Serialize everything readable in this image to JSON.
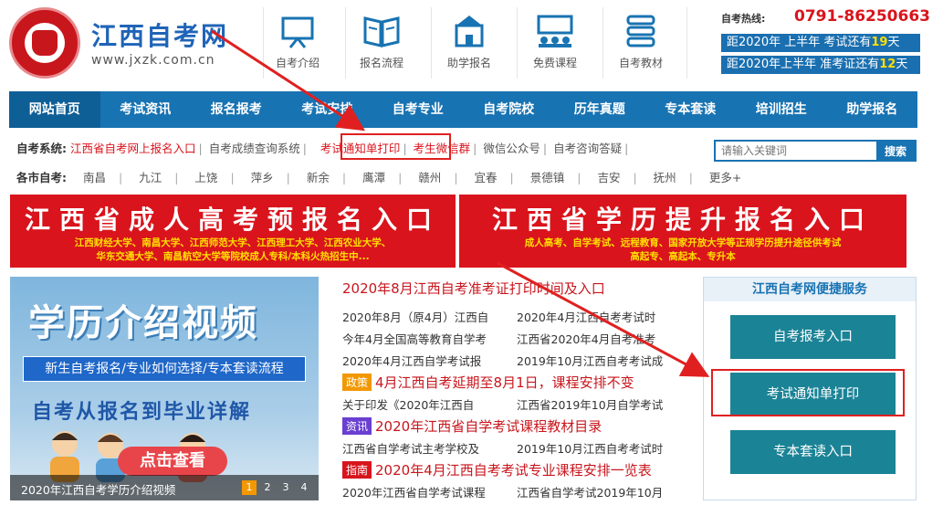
{
  "header": {
    "site_name": "江西自考网",
    "site_url": "www.jxzk.com.cn",
    "icons": [
      {
        "label": "自考介绍",
        "icon": "board-icon"
      },
      {
        "label": "报名流程",
        "icon": "book-icon"
      },
      {
        "label": "助学报名",
        "icon": "school-icon"
      },
      {
        "label": "免费课程",
        "icon": "class-icon"
      },
      {
        "label": "自考教材",
        "icon": "books-stack-icon"
      }
    ],
    "hotline_label": "自考热线:",
    "hotline": "0791-86250663",
    "countdown1": {
      "pre": "距2020年 上半年 考试还有",
      "num": "19",
      "post": "天"
    },
    "countdown2": {
      "pre": "距2020年上半年 准考证还有",
      "num": "12",
      "post": "天"
    }
  },
  "nav": [
    "网站首页",
    "考试资讯",
    "报名报考",
    "考试安排",
    "自考专业",
    "自考院校",
    "历年真题",
    "专本套读",
    "培训招生",
    "助学报名"
  ],
  "sysrow": {
    "lead": "自考系统:",
    "items": [
      "江西省自考网上报名入口",
      "自考成绩查询系统",
      "考试通知单打印",
      "考生微信群",
      "微信公众号",
      "自考咨询答疑"
    ]
  },
  "search": {
    "placeholder": "请输入关键词",
    "button": "搜索"
  },
  "cityrow": {
    "lead": "各市自考:",
    "cities": [
      "南昌",
      "九江",
      "上饶",
      "萍乡",
      "新余",
      "鹰潭",
      "赣州",
      "宜春",
      "景德镇",
      "吉安",
      "抚州",
      "更多+"
    ]
  },
  "banner_left": {
    "title": "江西省成人高考预报名入口",
    "line1": "江西财经大学、南昌大学、江西师范大学、江西理工大学、江西农业大学、",
    "line2": "华东交通大学、南昌航空大学等院校成人专科/本科火热招生中..."
  },
  "banner_right": {
    "title": "江西省学历提升报名入口",
    "line1": "成人高考、自学考试、远程教育、国家开放大学等正规学历提升途径供考试",
    "line2": "高起专、高起本、专升本"
  },
  "video": {
    "title": "学历介绍视频",
    "subtitle": "新生自考报名/专业如何选择/专本套读流程",
    "slogan": "自考从报名到毕业详解",
    "cta": "点击查看",
    "caption": "2020年江西自考学历介绍视频",
    "pages": [
      "1",
      "2",
      "3",
      "4"
    ]
  },
  "news": {
    "headline": "2020年8月江西自考准考证打印时间及入口",
    "rows": [
      [
        "2020年8月（原4月）江西自",
        "2020年4月江西自考考试时"
      ],
      [
        "今年4月全国高等教育自学考",
        "江西省2020年4月自考准考"
      ],
      [
        "2020年4月江西自学考试报",
        "2019年10月江西自考考试成"
      ]
    ],
    "tag1": {
      "tag": "政策",
      "title": "4月江西自考延期至8月1日，课程安排不变"
    },
    "rows2": [
      [
        "关于印发《2020年江西自",
        "江西省2019年10月自学考试"
      ]
    ],
    "tag2": {
      "tag": "资讯",
      "title": "2020年江西省自学考试课程教材目录"
    },
    "rows3": [
      [
        "江西省自学考试主考学校及",
        "2019年10月江西自考考试时"
      ]
    ],
    "tag3": {
      "tag": "指南",
      "title": "2020年4月江西自考考试专业课程安排一览表"
    },
    "rows4": [
      [
        "2020年江西省自学考试课程",
        "江西省自学考试2019年10月"
      ]
    ]
  },
  "quick": {
    "title": "江西自考网便捷服务",
    "buttons": [
      "自考报考入口",
      "考试通知单打印",
      "专本套读入口"
    ]
  },
  "colors": {
    "nav": "#1873b2",
    "accent_red": "#d9141c",
    "quick_btn": "#1b8396",
    "tag_policy": "#f39800",
    "tag_info": "#6a3fd1",
    "tag_guide": "#d9141c"
  }
}
